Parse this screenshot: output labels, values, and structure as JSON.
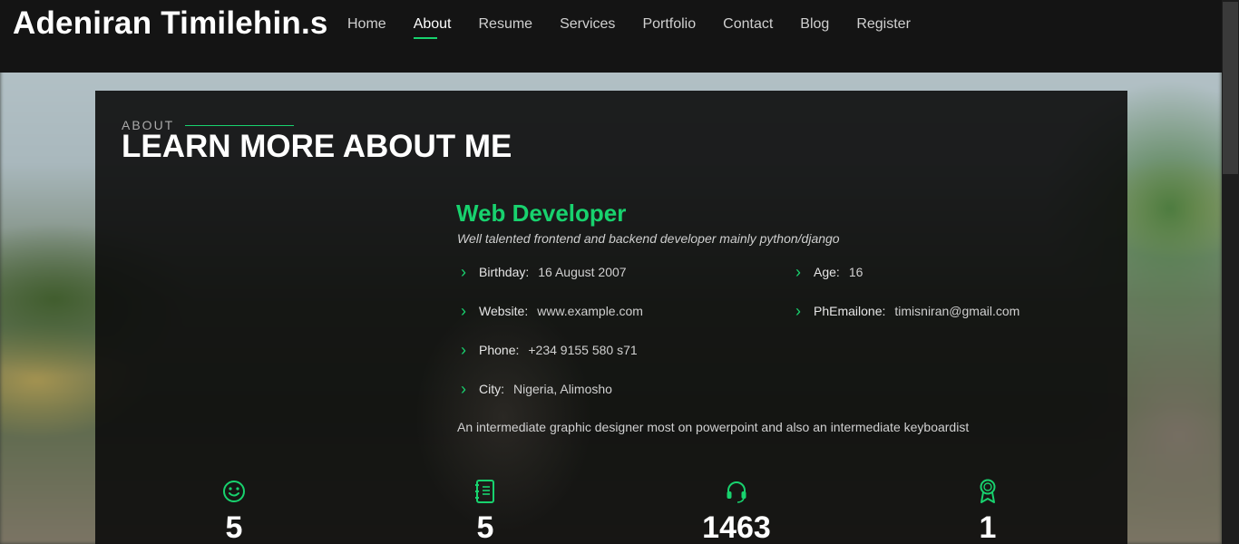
{
  "header": {
    "brand": "Adeniran Timilehin.s",
    "nav": [
      "Home",
      "About",
      "Resume",
      "Services",
      "Portfolio",
      "Contact",
      "Blog",
      "Register"
    ],
    "active": "About"
  },
  "about": {
    "subtitle": "ABOUT",
    "title": "LEARN MORE ABOUT ME",
    "role": "Web Developer",
    "tagline": "Well talented frontend and backend developer mainly python/django",
    "details_left": [
      {
        "label": "Birthday:",
        "value": "16 August 2007"
      },
      {
        "label": "Website:",
        "value": "www.example.com"
      },
      {
        "label": "Phone:",
        "value": "+234 9155 580 s71"
      },
      {
        "label": "City:",
        "value": "Nigeria, Alimosho"
      }
    ],
    "details_right": [
      {
        "label": "Age:",
        "value": "16"
      },
      {
        "label": "PhEmailone:",
        "value": "timisniran@gmail.com"
      }
    ],
    "description": "An intermediate graphic designer most on powerpoint and also an intermediate keyboardist"
  },
  "stats": [
    {
      "icon": "smiley-icon",
      "value": "5"
    },
    {
      "icon": "journal-icon",
      "value": "5"
    },
    {
      "icon": "headset-icon",
      "value": "1463"
    },
    {
      "icon": "award-icon",
      "value": "1"
    }
  ],
  "colors": {
    "accent": "#18d26e",
    "header_bg": "#141414"
  }
}
